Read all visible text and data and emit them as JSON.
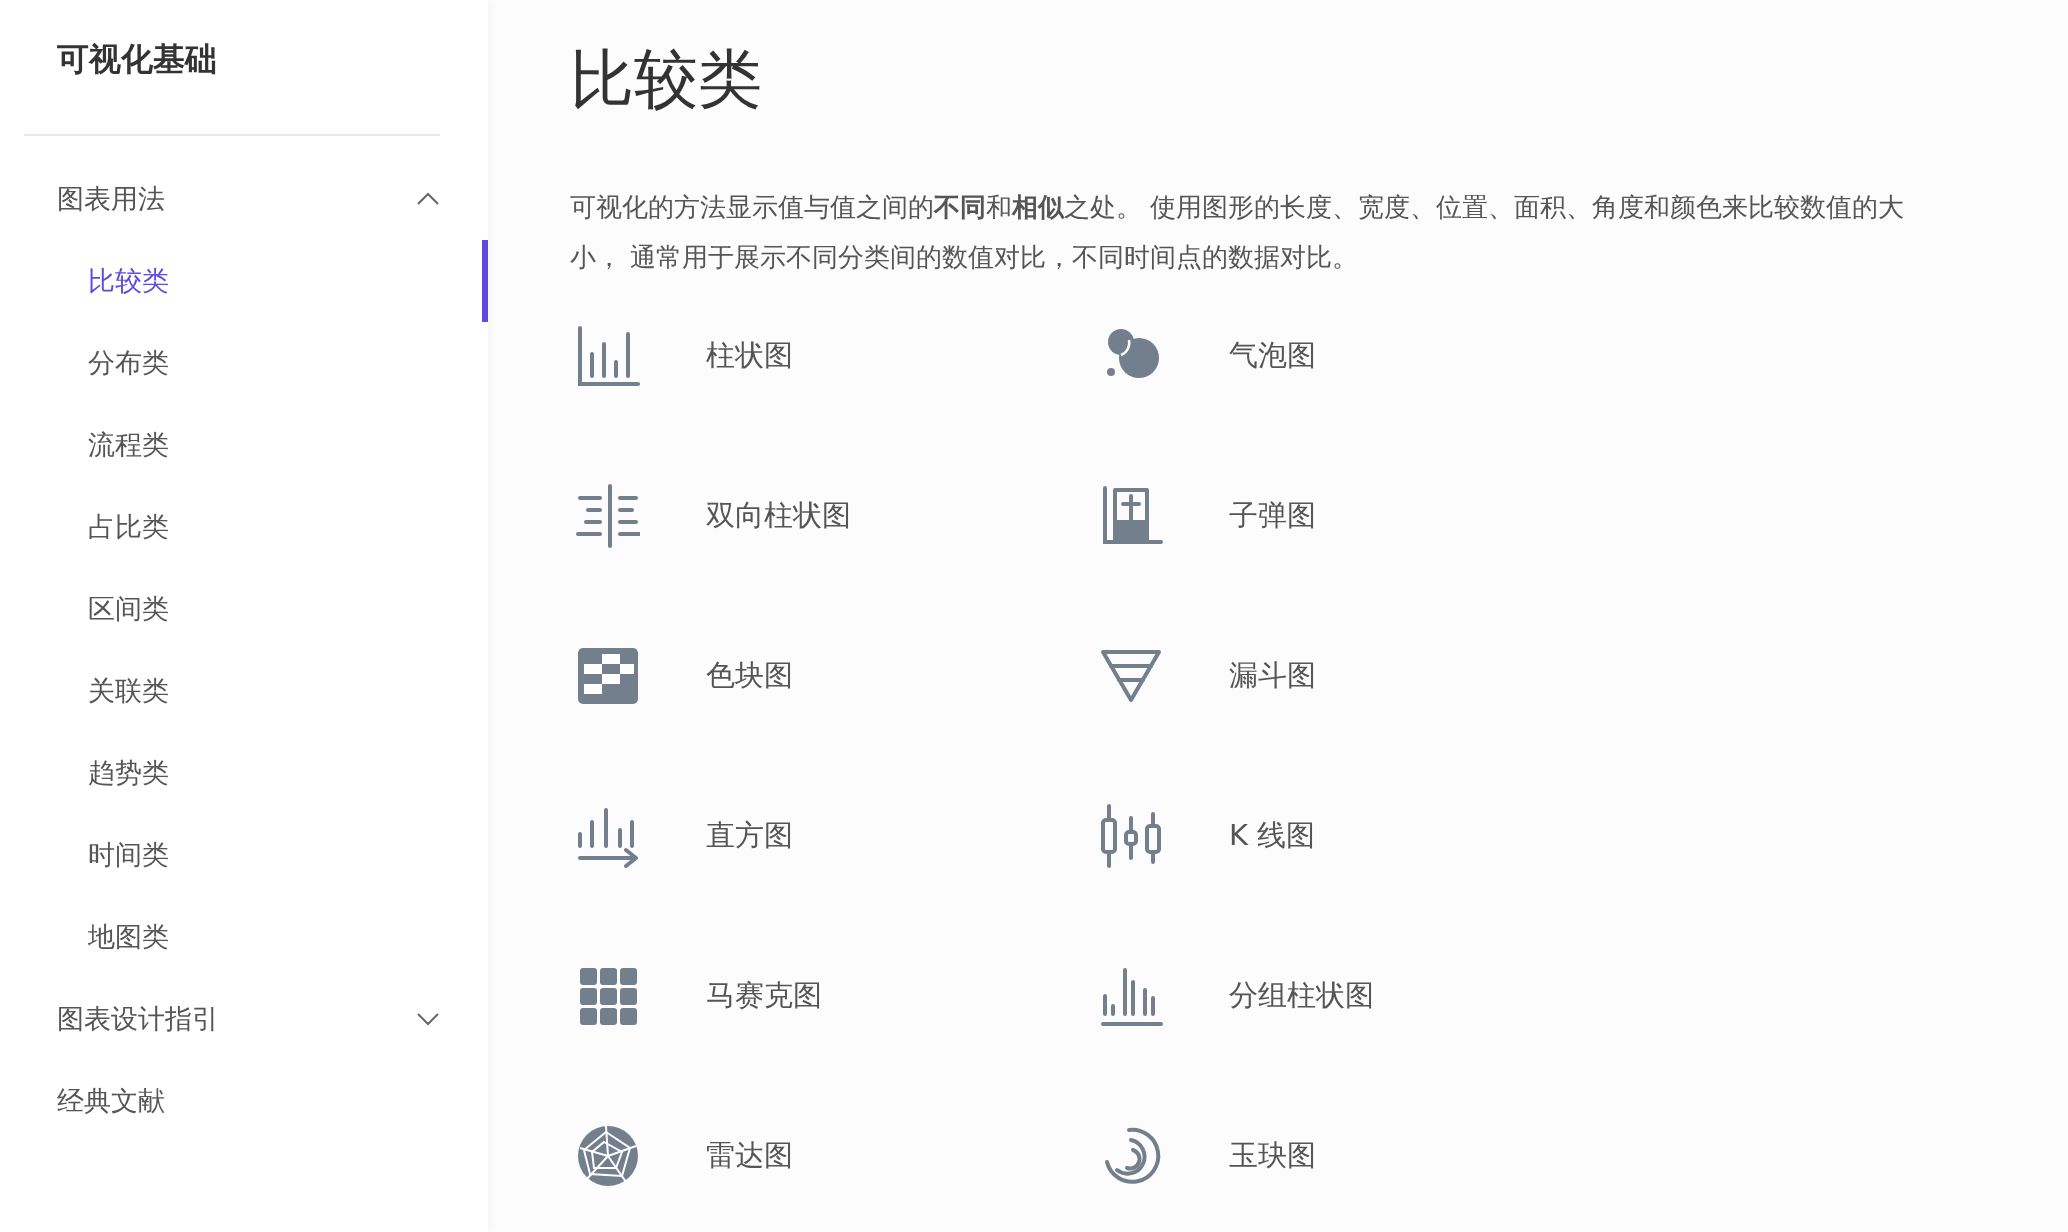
{
  "sidebar": {
    "title": "可视化基础",
    "groups": [
      {
        "label": "图表用法",
        "expanded": true,
        "children": [
          {
            "label": "比较类",
            "selected": true
          },
          {
            "label": "分布类",
            "selected": false
          },
          {
            "label": "流程类",
            "selected": false
          },
          {
            "label": "占比类",
            "selected": false
          },
          {
            "label": "区间类",
            "selected": false
          },
          {
            "label": "关联类",
            "selected": false
          },
          {
            "label": "趋势类",
            "selected": false
          },
          {
            "label": "时间类",
            "selected": false
          },
          {
            "label": "地图类",
            "selected": false
          }
        ]
      },
      {
        "label": "图表设计指引",
        "expanded": false
      },
      {
        "label": "经典文献"
      }
    ]
  },
  "main": {
    "heading": "比较类",
    "description": "可视化的方法显示值与值之间的**不同**和**相似**之处。 使用图形的长度、宽度、位置、面积、角度和颜色来比较数值的大小， 通常用于展示不同分类间的数值对比，不同时间点的数据对比。",
    "charts": [
      {
        "kind": "bar",
        "label": "柱状图"
      },
      {
        "kind": "bubble",
        "label": "气泡图"
      },
      {
        "kind": "bidirectional",
        "label": "双向柱状图"
      },
      {
        "kind": "bullet",
        "label": "子弹图"
      },
      {
        "kind": "heatmap",
        "label": "色块图"
      },
      {
        "kind": "funnel",
        "label": "漏斗图"
      },
      {
        "kind": "histogram",
        "label": "直方图"
      },
      {
        "kind": "candlestick",
        "label": "K 线图"
      },
      {
        "kind": "mosaic",
        "label": "马赛克图"
      },
      {
        "kind": "grouped",
        "label": "分组柱状图"
      },
      {
        "kind": "radar",
        "label": "雷达图"
      },
      {
        "kind": "radial",
        "label": "玉玦图"
      }
    ]
  }
}
